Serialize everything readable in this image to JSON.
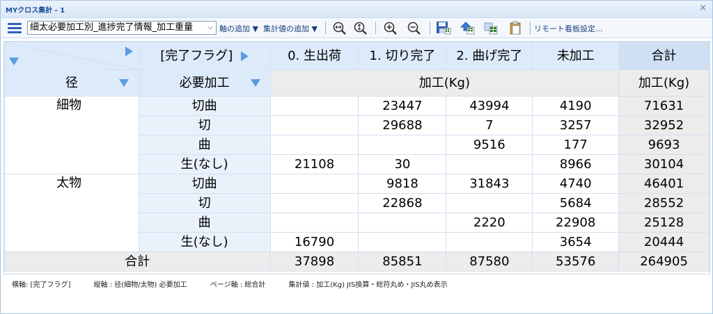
{
  "window": {
    "title": "MYクロス集計 - 1",
    "close": "×"
  },
  "toolbar": {
    "report_select": "細太必要加工別_進捗完了情報_加工重量",
    "add_axis": "軸の追加 ▼",
    "add_agg": "集計値の追加 ▼",
    "remote_board": "リモート看板設定..."
  },
  "grid": {
    "col_axis_label": "[完了フラグ]",
    "columns": [
      "0. 生出荷",
      "1. 切り完了",
      "2. 曲げ完了",
      "未加工"
    ],
    "total_label": "合計",
    "row_axis1": "径",
    "row_axis2": "必要加工",
    "measure_label": "加工(Kg)",
    "groups": [
      {
        "name": "細物",
        "rows": [
          {
            "label": "切曲",
            "cells": [
              "",
              "23447",
              "43994",
              "4190"
            ],
            "total": "71631"
          },
          {
            "label": "切",
            "cells": [
              "",
              "29688",
              "7",
              "3257"
            ],
            "total": "32952"
          },
          {
            "label": "曲",
            "cells": [
              "",
              "",
              "9516",
              "177"
            ],
            "total": "9693"
          },
          {
            "label": "生(なし)",
            "cells": [
              "21108",
              "30",
              "",
              "8966"
            ],
            "total": "30104"
          }
        ]
      },
      {
        "name": "太物",
        "rows": [
          {
            "label": "切曲",
            "cells": [
              "",
              "9818",
              "31843",
              "4740"
            ],
            "total": "46401"
          },
          {
            "label": "切",
            "cells": [
              "",
              "22868",
              "",
              "5684"
            ],
            "total": "28552"
          },
          {
            "label": "曲",
            "cells": [
              "",
              "",
              "2220",
              "22908"
            ],
            "total": "25128"
          },
          {
            "label": "生(なし)",
            "cells": [
              "16790",
              "",
              "",
              "3654"
            ],
            "total": "20444"
          }
        ]
      }
    ],
    "grand_total": {
      "label": "合計",
      "cells": [
        "37898",
        "85851",
        "87580",
        "53576"
      ],
      "total": "264905"
    }
  },
  "footer": {
    "horizontal_axis": "横軸: [完了フラグ]",
    "vertical_axis": "縦軸 : 径(細物/太物) 必要加工",
    "page_axis": "ページ軸 : 総合計",
    "agg_value": "集計値 :  加工(Kg)  JIS換算・総符丸め・JIS丸め表示"
  }
}
